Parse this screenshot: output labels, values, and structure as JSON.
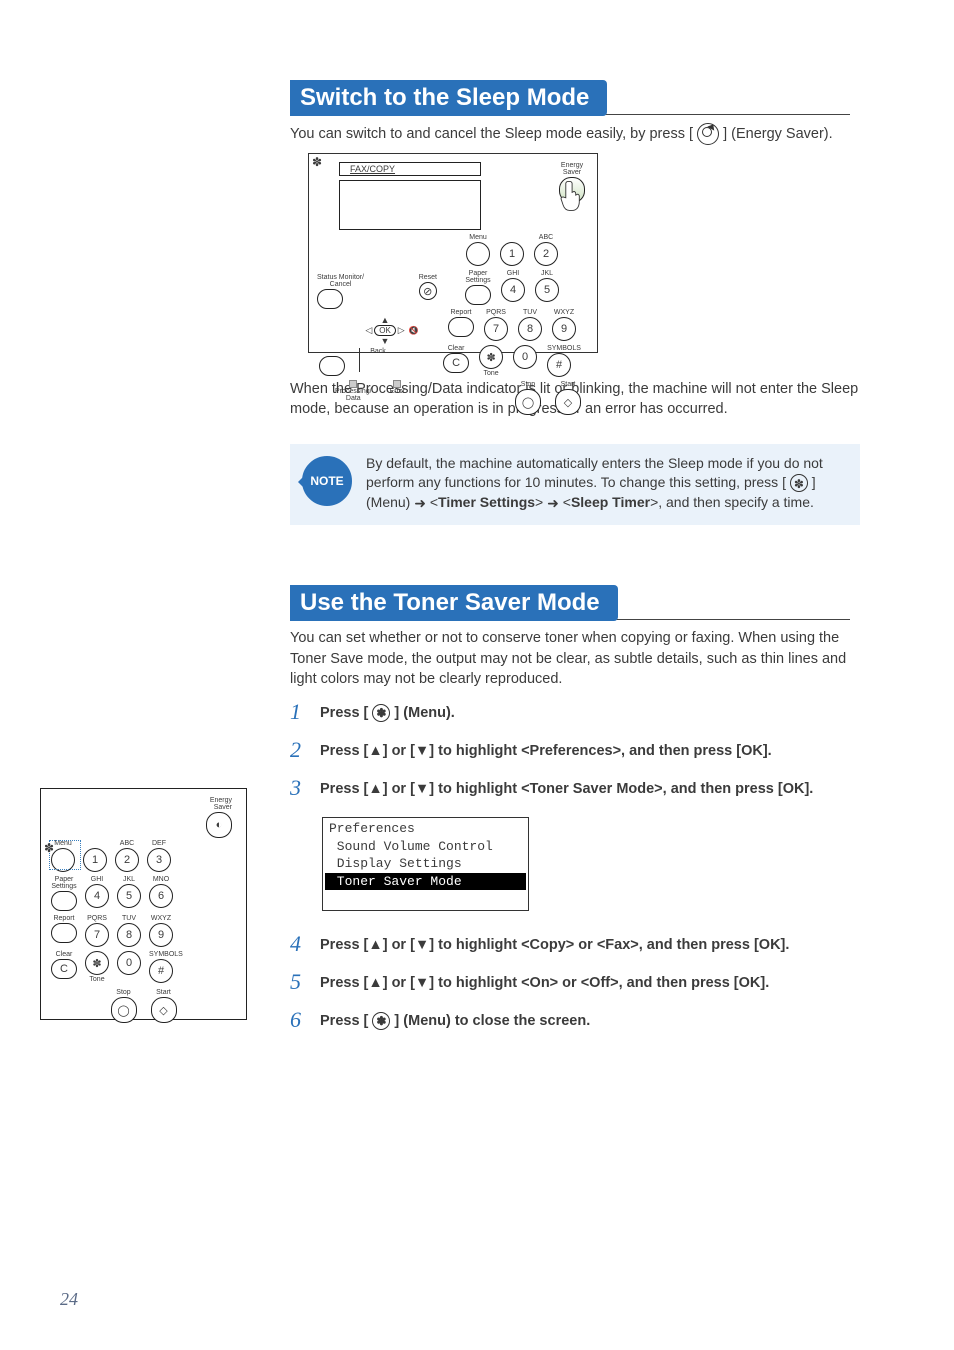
{
  "page_number": "24",
  "section1": {
    "heading": "Switch to the Sleep Mode",
    "intro_pre": "You can switch to and cancel the Sleep mode easily, by press [ ",
    "intro_post": " ] (Energy Saver).",
    "caption": "When the Processing/Data indicator is lit or blinking, the machine will not enter the Sleep mode, because an operation is in progress or an error has occurred.",
    "note_label": "NOTE",
    "note_pre": "By default, the machine automatically enters the Sleep mode if you do not perform any functions for 10 minutes. To change this setting, press [ ",
    "note_mid": " ] (Menu) ",
    "note_timer": "Timer Settings",
    "note_sleep": "Sleep Timer",
    "note_post": ">, and then specify a time."
  },
  "panel_labels": {
    "fax_copy": "FAX/COPY",
    "energy_saver": "Energy\nSaver",
    "menu": "Menu",
    "paper_settings": "Paper\nSettings",
    "report": "Report",
    "clear": "Clear",
    "abc": "ABC",
    "def": "DEF",
    "ghi": "GHI",
    "jkl": "JKL",
    "mno": "MNO",
    "pqrs": "PQRS",
    "tuv": "TUV",
    "wxyz": "WXYZ",
    "symbols": "SYMBOLS",
    "tone": "Tone",
    "start": "Start",
    "stop": "Stop",
    "status_monitor": "Status Monitor/\nCancel",
    "reset": "Reset",
    "back": "Back",
    "ok": "OK",
    "processing": "Processing/\nData",
    "error": "Error",
    "k1": "1",
    "k2": "2",
    "k3": "3",
    "k4": "4",
    "k5": "5",
    "k6": "6",
    "k7": "7",
    "k8": "8",
    "k9": "9",
    "k0": "0",
    "kstar": "✽",
    "khash": "#",
    "kc": "C"
  },
  "section2": {
    "heading": "Use the Toner Saver Mode",
    "intro": "You can set whether or not to conserve toner when copying or faxing. When using the Toner Save mode, the output may not be clear, as subtle details, such as thin lines and light colors may not be clearly reproduced.",
    "steps": {
      "s1": {
        "num": "1",
        "pre": "Press [ ",
        "post": " ] (Menu)."
      },
      "s2": {
        "num": "2",
        "text": "Press [▲] or [▼] to highlight <Preferences>, and then press [OK]."
      },
      "s3": {
        "num": "3",
        "text": "Press [▲] or [▼] to highlight <Toner Saver Mode>, and then press [OK]."
      },
      "s4": {
        "num": "4",
        "text": "Press [▲] or [▼] to highlight <Copy> or <Fax>, and then press [OK]."
      },
      "s5": {
        "num": "5",
        "text": "Press [▲] or [▼] to highlight <On> or <Off>, and then press [OK]."
      },
      "s6": {
        "num": "6",
        "pre": "Press [ ",
        "post": " ] (Menu) to close the screen."
      }
    },
    "lcd": {
      "title": "Preferences",
      "row1": " Sound Volume Control",
      "row2": " Display Settings",
      "row3": " Toner Saver Mode"
    }
  }
}
